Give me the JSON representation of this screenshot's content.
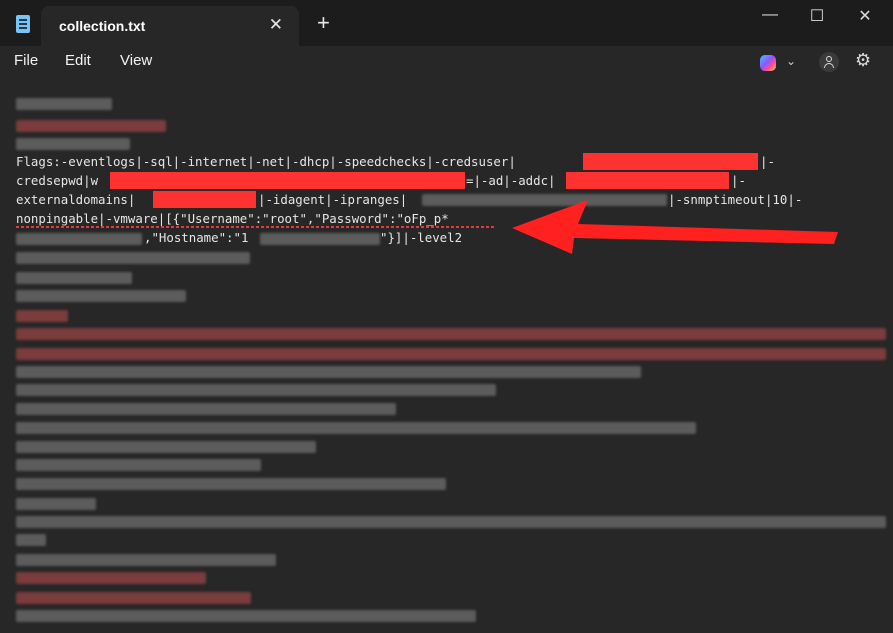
{
  "window": {
    "tab_title": "collection.txt",
    "tab_close": "✕",
    "new_tab": "+",
    "controls": {
      "minimize": "—",
      "maximize": "☐",
      "close": "✕"
    }
  },
  "menu": {
    "file": "File",
    "edit": "Edit",
    "view": "View"
  },
  "toolbar": {
    "chevron": "⌄",
    "settings": "⚙"
  },
  "editor": {
    "line1": "Flags:-eventlogs|-sql|-internet|-net|-dhcp|-speedchecks|-credsuser|",
    "line1_end": "|-",
    "line2_start": "credsepwd|w",
    "line2_mid": "=|-ad|-addc|",
    "line2_end": "|-",
    "line3_start": "externaldomains|",
    "line3_mid": "|-idagent|-ipranges|",
    "line3_end": "|-snmptimeout|10|-",
    "line4": "nonpingable|-vmware|[{\"Username\":\"root\",\"Password\":\"oFp_p*",
    "line5_mid": ",\"Hostname\":\"1",
    "line5_end": "\"}]|-level2"
  },
  "colors": {
    "annotation_red": "#ff3232",
    "background": "#272727",
    "titlebar": "#1c1c1c"
  }
}
